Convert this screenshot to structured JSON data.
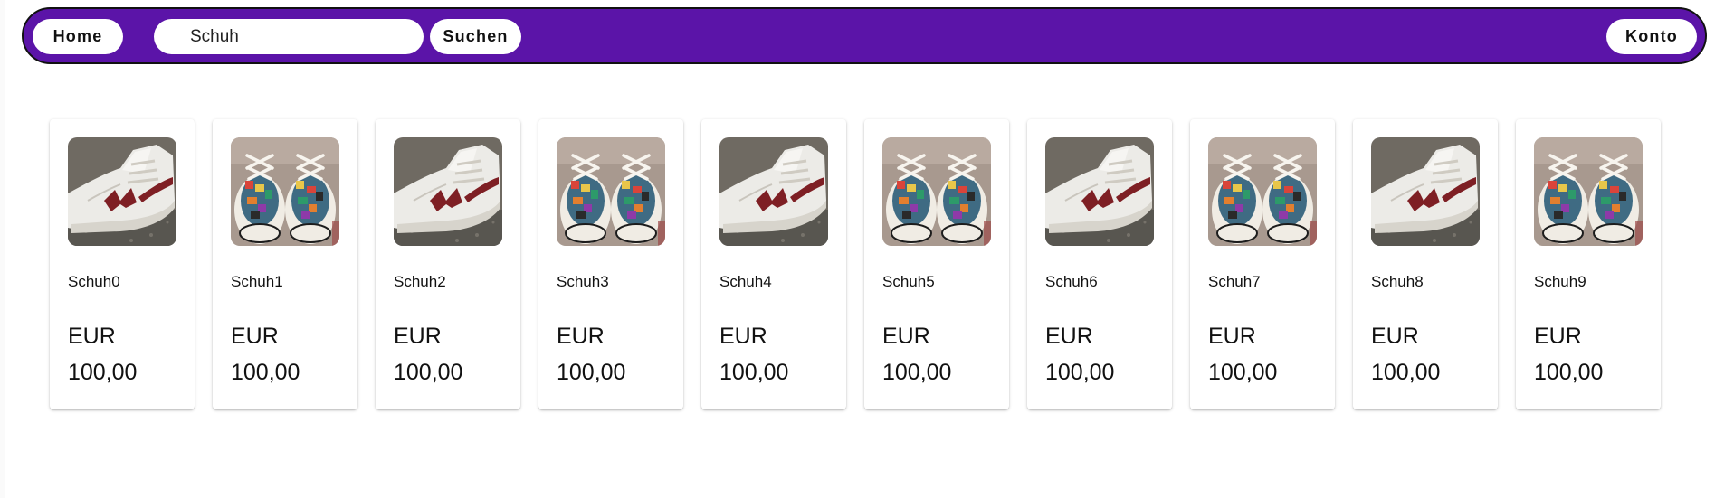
{
  "nav": {
    "home_label": "Home",
    "search": {
      "value": "Schuh",
      "placeholder": ""
    },
    "search_label": "Suchen",
    "account_label": "Konto"
  },
  "colors": {
    "nav_background": "#5b14a8",
    "nav_border": "#111111",
    "pill_background": "#ffffff"
  },
  "products": [
    {
      "name": "Schuh0",
      "currency": "EUR",
      "price": "100,00",
      "image": "white-high-top-sneaker"
    },
    {
      "name": "Schuh1",
      "currency": "EUR",
      "price": "100,00",
      "image": "patterned-canvas-sneakers"
    },
    {
      "name": "Schuh2",
      "currency": "EUR",
      "price": "100,00",
      "image": "white-high-top-sneaker"
    },
    {
      "name": "Schuh3",
      "currency": "EUR",
      "price": "100,00",
      "image": "patterned-canvas-sneakers"
    },
    {
      "name": "Schuh4",
      "currency": "EUR",
      "price": "100,00",
      "image": "white-high-top-sneaker"
    },
    {
      "name": "Schuh5",
      "currency": "EUR",
      "price": "100,00",
      "image": "patterned-canvas-sneakers"
    },
    {
      "name": "Schuh6",
      "currency": "EUR",
      "price": "100,00",
      "image": "white-high-top-sneaker"
    },
    {
      "name": "Schuh7",
      "currency": "EUR",
      "price": "100,00",
      "image": "patterned-canvas-sneakers"
    },
    {
      "name": "Schuh8",
      "currency": "EUR",
      "price": "100,00",
      "image": "white-high-top-sneaker"
    },
    {
      "name": "Schuh9",
      "currency": "EUR",
      "price": "100,00",
      "image": "patterned-canvas-sneakers"
    }
  ]
}
